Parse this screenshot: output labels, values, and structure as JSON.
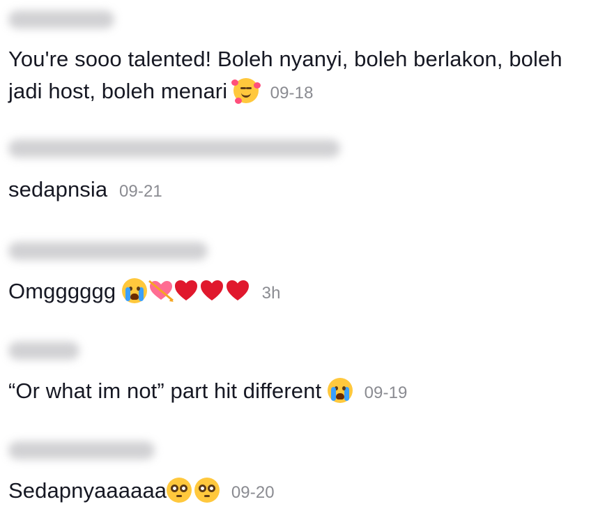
{
  "comments": [
    {
      "text": "You're sooo talented! Boleh nyanyi, boleh berlakon, boleh jadi host, boleh menari",
      "emojis": [
        "smiling-face-with-hearts"
      ],
      "time": "09-18"
    },
    {
      "text": "sedapnsia",
      "emojis": [],
      "time": "09-21"
    },
    {
      "text": "Omgggggg",
      "emojis": [
        "loudly-crying-face",
        "heart-with-arrow",
        "red-heart",
        "red-heart",
        "red-heart"
      ],
      "time": "3h"
    },
    {
      "text": "“Or what im not” part hit different",
      "emojis": [
        "loudly-crying-face"
      ],
      "time": "09-19"
    },
    {
      "text": "Sedapnyaaaaaa",
      "emojis": [
        "pleading-face",
        "pleading-face"
      ],
      "time": "09-20"
    }
  ],
  "colors": {
    "text": "#161823",
    "time": "#8a8b91",
    "heart": "#e0182d",
    "emoji": "#ffc83d"
  }
}
